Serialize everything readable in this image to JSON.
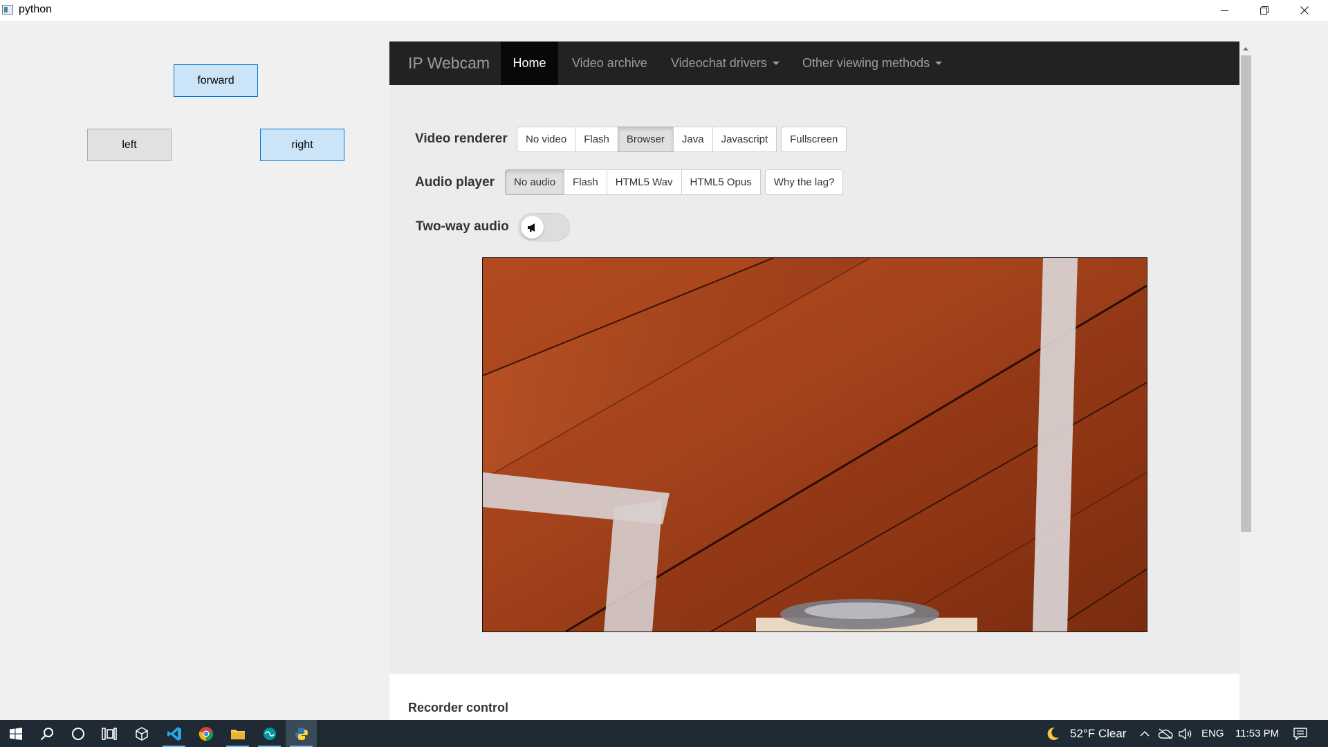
{
  "window": {
    "title": "python",
    "minimize_glyph": "—",
    "maximize_glyph": "❐",
    "close_glyph": "✕"
  },
  "controls": {
    "forward": "forward",
    "left": "left",
    "right": "right"
  },
  "navbar": {
    "brand": "IP Webcam",
    "items": [
      "Home",
      "Video archive",
      "Videochat drivers",
      "Other viewing methods"
    ],
    "active": "Home"
  },
  "video_renderer": {
    "label": "Video renderer",
    "options": [
      "No video",
      "Flash",
      "Browser",
      "Java",
      "Javascript"
    ],
    "selected": "Browser",
    "fullscreen": "Fullscreen"
  },
  "audio_player": {
    "label": "Audio player",
    "options": [
      "No audio",
      "Flash",
      "HTML5 Wav",
      "HTML5 Opus"
    ],
    "selected": "No audio",
    "help": "Why the lag?"
  },
  "two_way_audio": {
    "label": "Two-way audio",
    "enabled": false,
    "icon": "megaphone-icon"
  },
  "recorder": {
    "title": "Recorder control"
  },
  "taskbar": {
    "weather_icon": "moon-icon",
    "weather": "52°F  Clear",
    "language": "ENG",
    "time": "11:53 PM"
  },
  "colors": {
    "navbar_bg": "#222222",
    "nav_active_bg": "#080808",
    "qt_highlight": "#cce4f7",
    "taskbar_bg": "#1f2a35"
  }
}
